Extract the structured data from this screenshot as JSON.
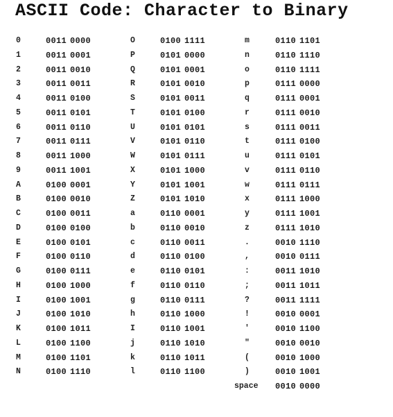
{
  "title": "ASCII Code: Character to Binary",
  "columns": [
    {
      "rows": [
        {
          "char": "0",
          "binary_high": "0011",
          "binary_low": "0000"
        },
        {
          "char": "1",
          "binary_high": "0011",
          "binary_low": "0001"
        },
        {
          "char": "2",
          "binary_high": "0011",
          "binary_low": "0010"
        },
        {
          "char": "3",
          "binary_high": "0011",
          "binary_low": "0011"
        },
        {
          "char": "4",
          "binary_high": "0011",
          "binary_low": "0100"
        },
        {
          "char": "5",
          "binary_high": "0011",
          "binary_low": "0101"
        },
        {
          "char": "6",
          "binary_high": "0011",
          "binary_low": "0110"
        },
        {
          "char": "7",
          "binary_high": "0011",
          "binary_low": "0111"
        },
        {
          "char": "8",
          "binary_high": "0011",
          "binary_low": "1000"
        },
        {
          "char": "9",
          "binary_high": "0011",
          "binary_low": "1001"
        },
        {
          "char": "A",
          "binary_high": "0100",
          "binary_low": "0001"
        },
        {
          "char": "B",
          "binary_high": "0100",
          "binary_low": "0010"
        },
        {
          "char": "C",
          "binary_high": "0100",
          "binary_low": "0011"
        },
        {
          "char": "D",
          "binary_high": "0100",
          "binary_low": "0100"
        },
        {
          "char": "E",
          "binary_high": "0100",
          "binary_low": "0101"
        },
        {
          "char": "F",
          "binary_high": "0100",
          "binary_low": "0110"
        },
        {
          "char": "G",
          "binary_high": "0100",
          "binary_low": "0111"
        },
        {
          "char": "H",
          "binary_high": "0100",
          "binary_low": "1000"
        },
        {
          "char": "I",
          "binary_high": "0100",
          "binary_low": "1001"
        },
        {
          "char": "J",
          "binary_high": "0100",
          "binary_low": "1010"
        },
        {
          "char": "K",
          "binary_high": "0100",
          "binary_low": "1011"
        },
        {
          "char": "L",
          "binary_high": "0100",
          "binary_low": "1100"
        },
        {
          "char": "M",
          "binary_high": "0100",
          "binary_low": "1101"
        },
        {
          "char": "N",
          "binary_high": "0100",
          "binary_low": "1110"
        }
      ]
    },
    {
      "rows": [
        {
          "char": "O",
          "binary_high": "0100",
          "binary_low": "1111"
        },
        {
          "char": "P",
          "binary_high": "0101",
          "binary_low": "0000"
        },
        {
          "char": "Q",
          "binary_high": "0101",
          "binary_low": "0001"
        },
        {
          "char": "R",
          "binary_high": "0101",
          "binary_low": "0010"
        },
        {
          "char": "S",
          "binary_high": "0101",
          "binary_low": "0011"
        },
        {
          "char": "T",
          "binary_high": "0101",
          "binary_low": "0100"
        },
        {
          "char": "U",
          "binary_high": "0101",
          "binary_low": "0101"
        },
        {
          "char": "V",
          "binary_high": "0101",
          "binary_low": "0110"
        },
        {
          "char": "W",
          "binary_high": "0101",
          "binary_low": "0111"
        },
        {
          "char": "X",
          "binary_high": "0101",
          "binary_low": "1000"
        },
        {
          "char": "Y",
          "binary_high": "0101",
          "binary_low": "1001"
        },
        {
          "char": "Z",
          "binary_high": "0101",
          "binary_low": "1010"
        },
        {
          "char": "a",
          "binary_high": "0110",
          "binary_low": "0001"
        },
        {
          "char": "b",
          "binary_high": "0110",
          "binary_low": "0010"
        },
        {
          "char": "c",
          "binary_high": "0110",
          "binary_low": "0011"
        },
        {
          "char": "d",
          "binary_high": "0110",
          "binary_low": "0100"
        },
        {
          "char": "e",
          "binary_high": "0110",
          "binary_low": "0101"
        },
        {
          "char": "f",
          "binary_high": "0110",
          "binary_low": "0110"
        },
        {
          "char": "g",
          "binary_high": "0110",
          "binary_low": "0111"
        },
        {
          "char": "h",
          "binary_high": "0110",
          "binary_low": "1000"
        },
        {
          "char": "I",
          "binary_high": "0110",
          "binary_low": "1001"
        },
        {
          "char": "j",
          "binary_high": "0110",
          "binary_low": "1010"
        },
        {
          "char": "k",
          "binary_high": "0110",
          "binary_low": "1011"
        },
        {
          "char": "l",
          "binary_high": "0110",
          "binary_low": "1100"
        }
      ]
    },
    {
      "rows": [
        {
          "char": "m",
          "binary_high": "0110",
          "binary_low": "1101"
        },
        {
          "char": "n",
          "binary_high": "0110",
          "binary_low": "1110"
        },
        {
          "char": "o",
          "binary_high": "0110",
          "binary_low": "1111"
        },
        {
          "char": "p",
          "binary_high": "0111",
          "binary_low": "0000"
        },
        {
          "char": "q",
          "binary_high": "0111",
          "binary_low": "0001"
        },
        {
          "char": "r",
          "binary_high": "0111",
          "binary_low": "0010"
        },
        {
          "char": "s",
          "binary_high": "0111",
          "binary_low": "0011"
        },
        {
          "char": "t",
          "binary_high": "0111",
          "binary_low": "0100"
        },
        {
          "char": "u",
          "binary_high": "0111",
          "binary_low": "0101"
        },
        {
          "char": "v",
          "binary_high": "0111",
          "binary_low": "0110"
        },
        {
          "char": "w",
          "binary_high": "0111",
          "binary_low": "0111"
        },
        {
          "char": "x",
          "binary_high": "0111",
          "binary_low": "1000"
        },
        {
          "char": "y",
          "binary_high": "0111",
          "binary_low": "1001"
        },
        {
          "char": "z",
          "binary_high": "0111",
          "binary_low": "1010"
        },
        {
          "char": ".",
          "binary_high": "0010",
          "binary_low": "1110"
        },
        {
          "char": ",",
          "binary_high": "0010",
          "binary_low": "0111"
        },
        {
          "char": ":",
          "binary_high": "0011",
          "binary_low": "1010"
        },
        {
          "char": ";",
          "binary_high": "0011",
          "binary_low": "1011"
        },
        {
          "char": "?",
          "binary_high": "0011",
          "binary_low": "1111"
        },
        {
          "char": "!",
          "binary_high": "0010",
          "binary_low": "0001"
        },
        {
          "char": "'",
          "binary_high": "0010",
          "binary_low": "1100"
        },
        {
          "char": "\"",
          "binary_high": "0010",
          "binary_low": "0010"
        },
        {
          "char": "(",
          "binary_high": "0010",
          "binary_low": "1000"
        },
        {
          "char": ")",
          "binary_high": "0010",
          "binary_low": "1001"
        },
        {
          "char": "space",
          "binary_high": "0010",
          "binary_low": "0000"
        }
      ]
    }
  ]
}
